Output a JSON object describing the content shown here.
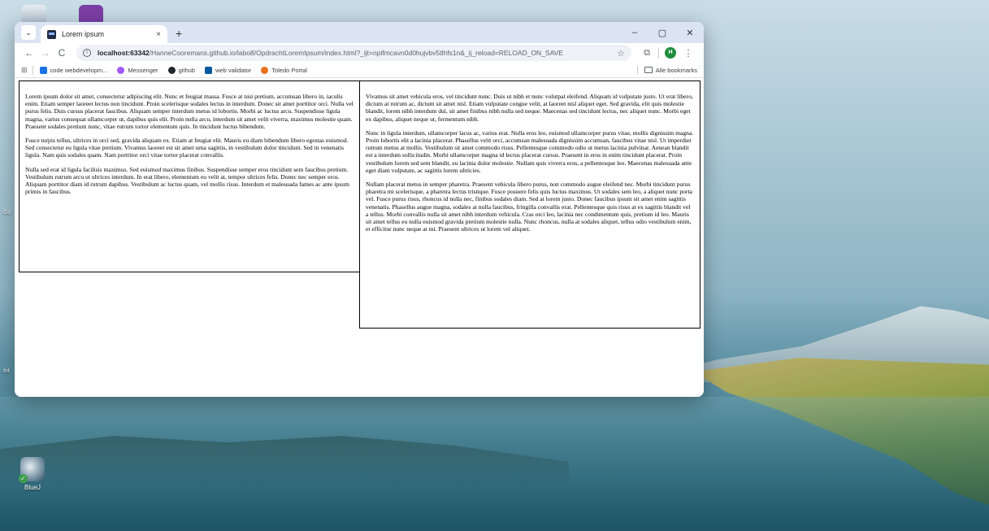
{
  "desktop": {
    "icons": [
      {
        "label": "BlueJ",
        "icon": "bluej-icon"
      }
    ],
    "side_labels": [
      "Go",
      "Int"
    ]
  },
  "browser": {
    "tab": {
      "title": "Lorem ipsum",
      "close": "×"
    },
    "new_tab": "+",
    "window_controls": {
      "minimize": "–",
      "maximize": "▢",
      "close": "✕"
    },
    "toolbar": {
      "back": "←",
      "forward": "→",
      "reload": "C",
      "url_host": "localhost:63342",
      "url_path": "/HanneCooremans.github.io/labo8/OpdrachtLoremIpsum/index.html?_ijt=nplfmcavn0d0hujvbv5tlhfs1n&_ij_reload=RELOAD_ON_SAVE",
      "profile_initial": "H"
    },
    "bookmarks": {
      "items": [
        {
          "label": "code webdevelopm...",
          "icon": "code-icon",
          "color": "#1a73e8"
        },
        {
          "label": "Messenger",
          "icon": "messenger-icon",
          "color": "#a259ff"
        },
        {
          "label": "github",
          "icon": "github-icon",
          "color": "#24292f"
        },
        {
          "label": "web validator",
          "icon": "w3c-icon",
          "color": "#005a9c"
        },
        {
          "label": "Toledo Portal",
          "icon": "toledo-icon",
          "color": "#e8711a"
        }
      ],
      "all_bookmarks": "Alle bookmarks"
    }
  },
  "content": {
    "left": [
      "Lorem ipsum dolor sit amet, consectetur adipiscing elit. Nunc et feugiat massa. Fusce at nisi pretium, accumsan libero in, iaculis enim. Etiam semper laoreet lectus non tincidunt. Proin scelerisque sodales lectus in interdum. Donec sit amet porttitor orci. Nulla vel purus felis. Duis cursus placerat faucibus. Aliquam semper interdum metus id lobortis. Morbi ac luctus arcu. Suspendisse ligula magna, varius consequat ullamcorper ut, dapibus quis elit. Proin nulla arcu, interdum sit amet velit viverra, maximus molestie quam. Praesent sodales pretium nunc, vitae rutrum tortor elementum quis. In tincidunt luctus bibendum.",
      "Fusce turpis tellus, ultrices in orci sed, gravida aliquam ex. Etiam at feugiat elit. Mauris eu diam bibendum libero egestas euismod. Sed consectetur eu ligula vitae pretium. Vivamus laoreet est sit amet urna sagittis, in vestibulum dolor tincidunt. Sed in venenatis ligula. Nam quis sodales quam. Nam porttitor orci vitae tortor placerat convallis.",
      "Nulla sed erat id ligula facilisis maximus. Sed euismod maximus finibus. Suspendisse semper eros tincidunt sem faucibus pretium. Vestibulum rutrum arcu ut ultrices interdum. In erat libero, elementum eu velit at, tempor ultrices felis. Donec nec semper eros. Aliquam porttitor diam id rutrum dapibus. Vestibulum ac luctus quam, vel mollis risus. Interdum et malesuada fames ac ante ipsum primis in faucibus."
    ],
    "right": [
      "Vivamus sit amet vehicula eros, vel tincidunt nunc. Duis ut nibh et nunc volutpat eleifend. Aliquam id vulputate justo. Ut erat libero, dictum at rutrum ac, dictum sit amet nisl. Etiam vulputate congue velit, at laoreet nisl aliquet eget. Sed gravida, elit quis molestie blandit, lorem nibh interdum dui, sit amet finibus nibh nulla sed neque. Maecenas sed tincidunt lectus, nec aliquet nunc. Morbi eget ex dapibus, aliquet neque ut, fermentum nibh.",
      "Nunc in ligula interdum, ullamcorper lacus ac, varius erat. Nulla eros leo, euismod ullamcorper purus vitae, mollis dignissim magna. Proin lobortis elit a lacinia placerat. Phasellus velit orci, accumsan malesuada dignissim accumsan, faucibus vitae nisl. Ut imperdiet rutrum metus at mollis. Vestibulum sit amet commodo risus. Pellentesque commodo odio ut metus lacinia pulvinar. Aenean blandit est a interdum sollicitudin. Morbi ullamcorper magna id lectus placerat cursus. Praesent in eros in enim tincidunt placerat. Proin vestibulum lorem sed sem blandit, eu lacinia dolor molestie. Nullam quis viverra eros, a pellentesque leo. Maecenas malesuada ante eget diam vulputate, ac sagittis lorem ultricies.",
      "Nullam placerat metus in semper pharetra. Praesent vehicula libero purus, non commodo augue eleifend nec. Morbi tincidunt purus pharetra mi scelerisque, a pharetra lectus tristique. Fusce posuere felis quis luctus maximus. Ut sodales sem leo, a aliquet nunc porta vel. Fusce purus risus, rhoncus id nulla nec, finibus sodales diam. Sed at lorem justo. Donec faucibus ipsum sit amet enim sagittis venenatis. Phasellus augue magna, sodales at nulla faucibus, fringilla convallis erat. Pellentesque quis risus at ex sagittis blandit vel a tellus. Morbi convallis nulla sit amet nibh interdum vehicula. Cras orci leo, lacinia nec condimentum quis, pretium id leo. Mauris sit amet tellus eu nulla euismod gravida pretium molestie nulla. Nunc rhoncus, nulla at sodales aliquet, tellus odio vestibulum enim, et efficitur nunc neque at mi. Praesent ultrices ut lorem vel aliquet."
    ]
  }
}
